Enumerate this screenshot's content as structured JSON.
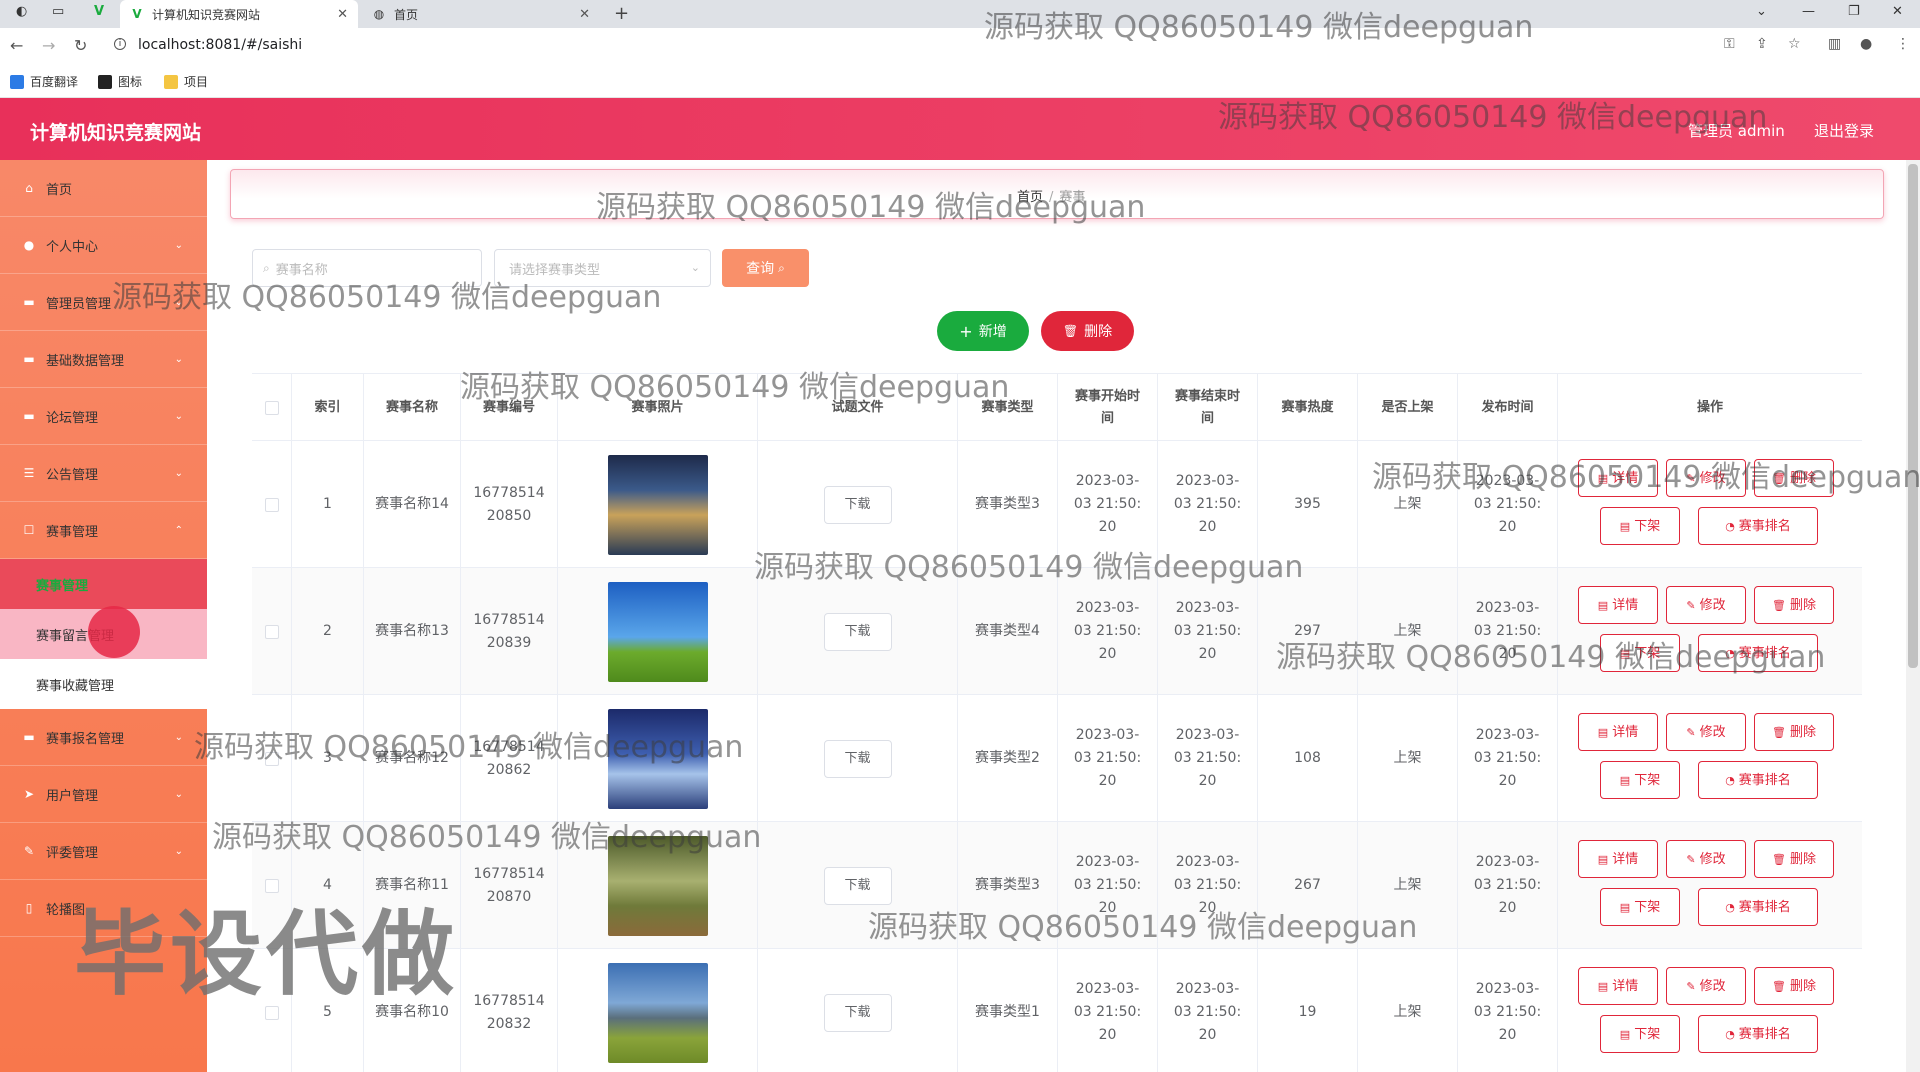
{
  "browser": {
    "tabs": [
      {
        "title": "计算机知识竞赛网站",
        "active": true
      },
      {
        "title": "首页",
        "active": false
      }
    ],
    "url": "localhost:8081/#/saishi",
    "bookmarks": [
      "百度翻译",
      "图标",
      "项目"
    ]
  },
  "header": {
    "title": "计算机知识竞赛网站",
    "admin": "管理员 admin",
    "logout": "退出登录"
  },
  "sidebar": {
    "items": [
      {
        "label": "首页",
        "icon": "home-icon"
      },
      {
        "label": "个人中心",
        "icon": "user-icon"
      },
      {
        "label": "管理员管理",
        "icon": "admin-icon"
      },
      {
        "label": "基础数据管理",
        "icon": "data-icon"
      },
      {
        "label": "论坛管理",
        "icon": "forum-icon"
      },
      {
        "label": "公告管理",
        "icon": "notice-icon"
      },
      {
        "label": "赛事管理",
        "icon": "contest-icon"
      }
    ],
    "sub_items": [
      "赛事管理",
      "赛事留言管理",
      "赛事收藏管理"
    ],
    "items_after": [
      {
        "label": "赛事报名管理",
        "icon": "signup-icon"
      },
      {
        "label": "用户管理",
        "icon": "users-icon"
      },
      {
        "label": "评委管理",
        "icon": "judge-icon"
      },
      {
        "label": "轮播图",
        "icon": "carousel-icon"
      }
    ]
  },
  "breadcrumb": {
    "home": "首页",
    "current": "赛事"
  },
  "search": {
    "name_placeholder": "赛事名称",
    "type_placeholder": "请选择赛事类型",
    "query_label": "查询"
  },
  "actions": {
    "add_label": "新增",
    "delete_label": "删除"
  },
  "table": {
    "headers": [
      "索引",
      "赛事名称",
      "赛事编号",
      "赛事照片",
      "试题文件",
      "赛事类型",
      "赛事开始时间",
      "赛事结束时间",
      "赛事热度",
      "是否上架",
      "发布时间",
      "操作"
    ],
    "download_label": "下载",
    "op_labels": {
      "detail": "详情",
      "edit": "修改",
      "delete": "删除",
      "offshelf": "下架",
      "rank": "赛事排名"
    },
    "rows": [
      {
        "index": "1",
        "name": "赛事名称14",
        "code": "1677851420850",
        "type": "赛事类型3",
        "start": "2023-03-03 21:50:20",
        "end": "2023-03-03 21:50:20",
        "heat": "395",
        "shelf": "上架",
        "published": "2023-03-03 21:50:20",
        "photo": "city-night"
      },
      {
        "index": "2",
        "name": "赛事名称13",
        "code": "1677851420839",
        "type": "赛事类型4",
        "start": "2023-03-03 21:50:20",
        "end": "2023-03-03 21:50:20",
        "heat": "297",
        "shelf": "上架",
        "published": "2023-03-03 21:50:20",
        "photo": "green-field"
      },
      {
        "index": "3",
        "name": "赛事名称12",
        "code": "1677851420862",
        "type": "赛事类型2",
        "start": "2023-03-03 21:50:20",
        "end": "2023-03-03 21:50:20",
        "heat": "108",
        "shelf": "上架",
        "published": "2023-03-03 21:50:20",
        "photo": "night-sky"
      },
      {
        "index": "4",
        "name": "赛事名称11",
        "code": "1677851420870",
        "type": "赛事类型3",
        "start": "2023-03-03 21:50:20",
        "end": "2023-03-03 21:50:20",
        "heat": "267",
        "shelf": "上架",
        "published": "2023-03-03 21:50:20",
        "photo": "forest-path"
      },
      {
        "index": "5",
        "name": "赛事名称10",
        "code": "1677851420832",
        "type": "赛事类型1",
        "start": "2023-03-03 21:50:20",
        "end": "2023-03-03 21:50:20",
        "heat": "19",
        "shelf": "上架",
        "published": "2023-03-03 21:50:20",
        "photo": "mountain-meadow"
      }
    ]
  },
  "watermarks": {
    "text": "源码获取 QQ86050149 微信deepguan",
    "big": "毕设代做"
  },
  "colors": {
    "primary": "#e8305a",
    "sidebar": "#f8774c",
    "add": "#1aab3e",
    "danger": "#e0263a",
    "query": "#f9906a"
  }
}
